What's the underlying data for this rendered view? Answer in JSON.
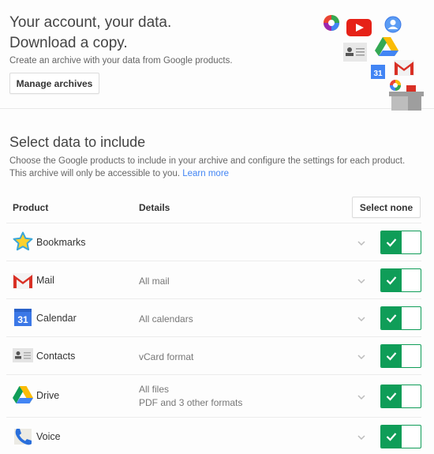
{
  "hero": {
    "title_line1": "Your account, your data.",
    "title_line2": "Download a copy.",
    "subtitle": "Create an archive with your data from Google products.",
    "manage_button": "Manage archives",
    "collage_icons": [
      "picasa-icon",
      "youtube-icon",
      "profile-icon",
      "drive-icon",
      "contacts-icon",
      "calendar-icon",
      "gmail-icon",
      "hangouts-icon",
      "archive-box-icon"
    ]
  },
  "select_section": {
    "title": "Select data to include",
    "description": "Choose the Google products to include in your archive and configure the settings for each product. This archive will only be accessible to you.",
    "learn_more": "Learn more"
  },
  "table": {
    "headers": {
      "product": "Product",
      "details": "Details"
    },
    "select_none_button": "Select none",
    "rows": [
      {
        "name": "Bookmarks",
        "icon": "bookmarks-star-icon",
        "details": [],
        "enabled": true
      },
      {
        "name": "Mail",
        "icon": "gmail-icon",
        "details": [
          "All mail"
        ],
        "enabled": true
      },
      {
        "name": "Calendar",
        "icon": "calendar-icon",
        "details": [
          "All calendars"
        ],
        "enabled": true
      },
      {
        "name": "Contacts",
        "icon": "contacts-icon",
        "details": [
          "vCard format"
        ],
        "enabled": true
      },
      {
        "name": "Drive",
        "icon": "drive-icon",
        "details": [
          "All files",
          "PDF and 3 other formats"
        ],
        "enabled": true
      },
      {
        "name": "Voice",
        "icon": "voice-phone-icon",
        "details": [],
        "enabled": true
      }
    ]
  },
  "colors": {
    "toggle_on": "#0f9d58",
    "link": "#4285f4"
  }
}
